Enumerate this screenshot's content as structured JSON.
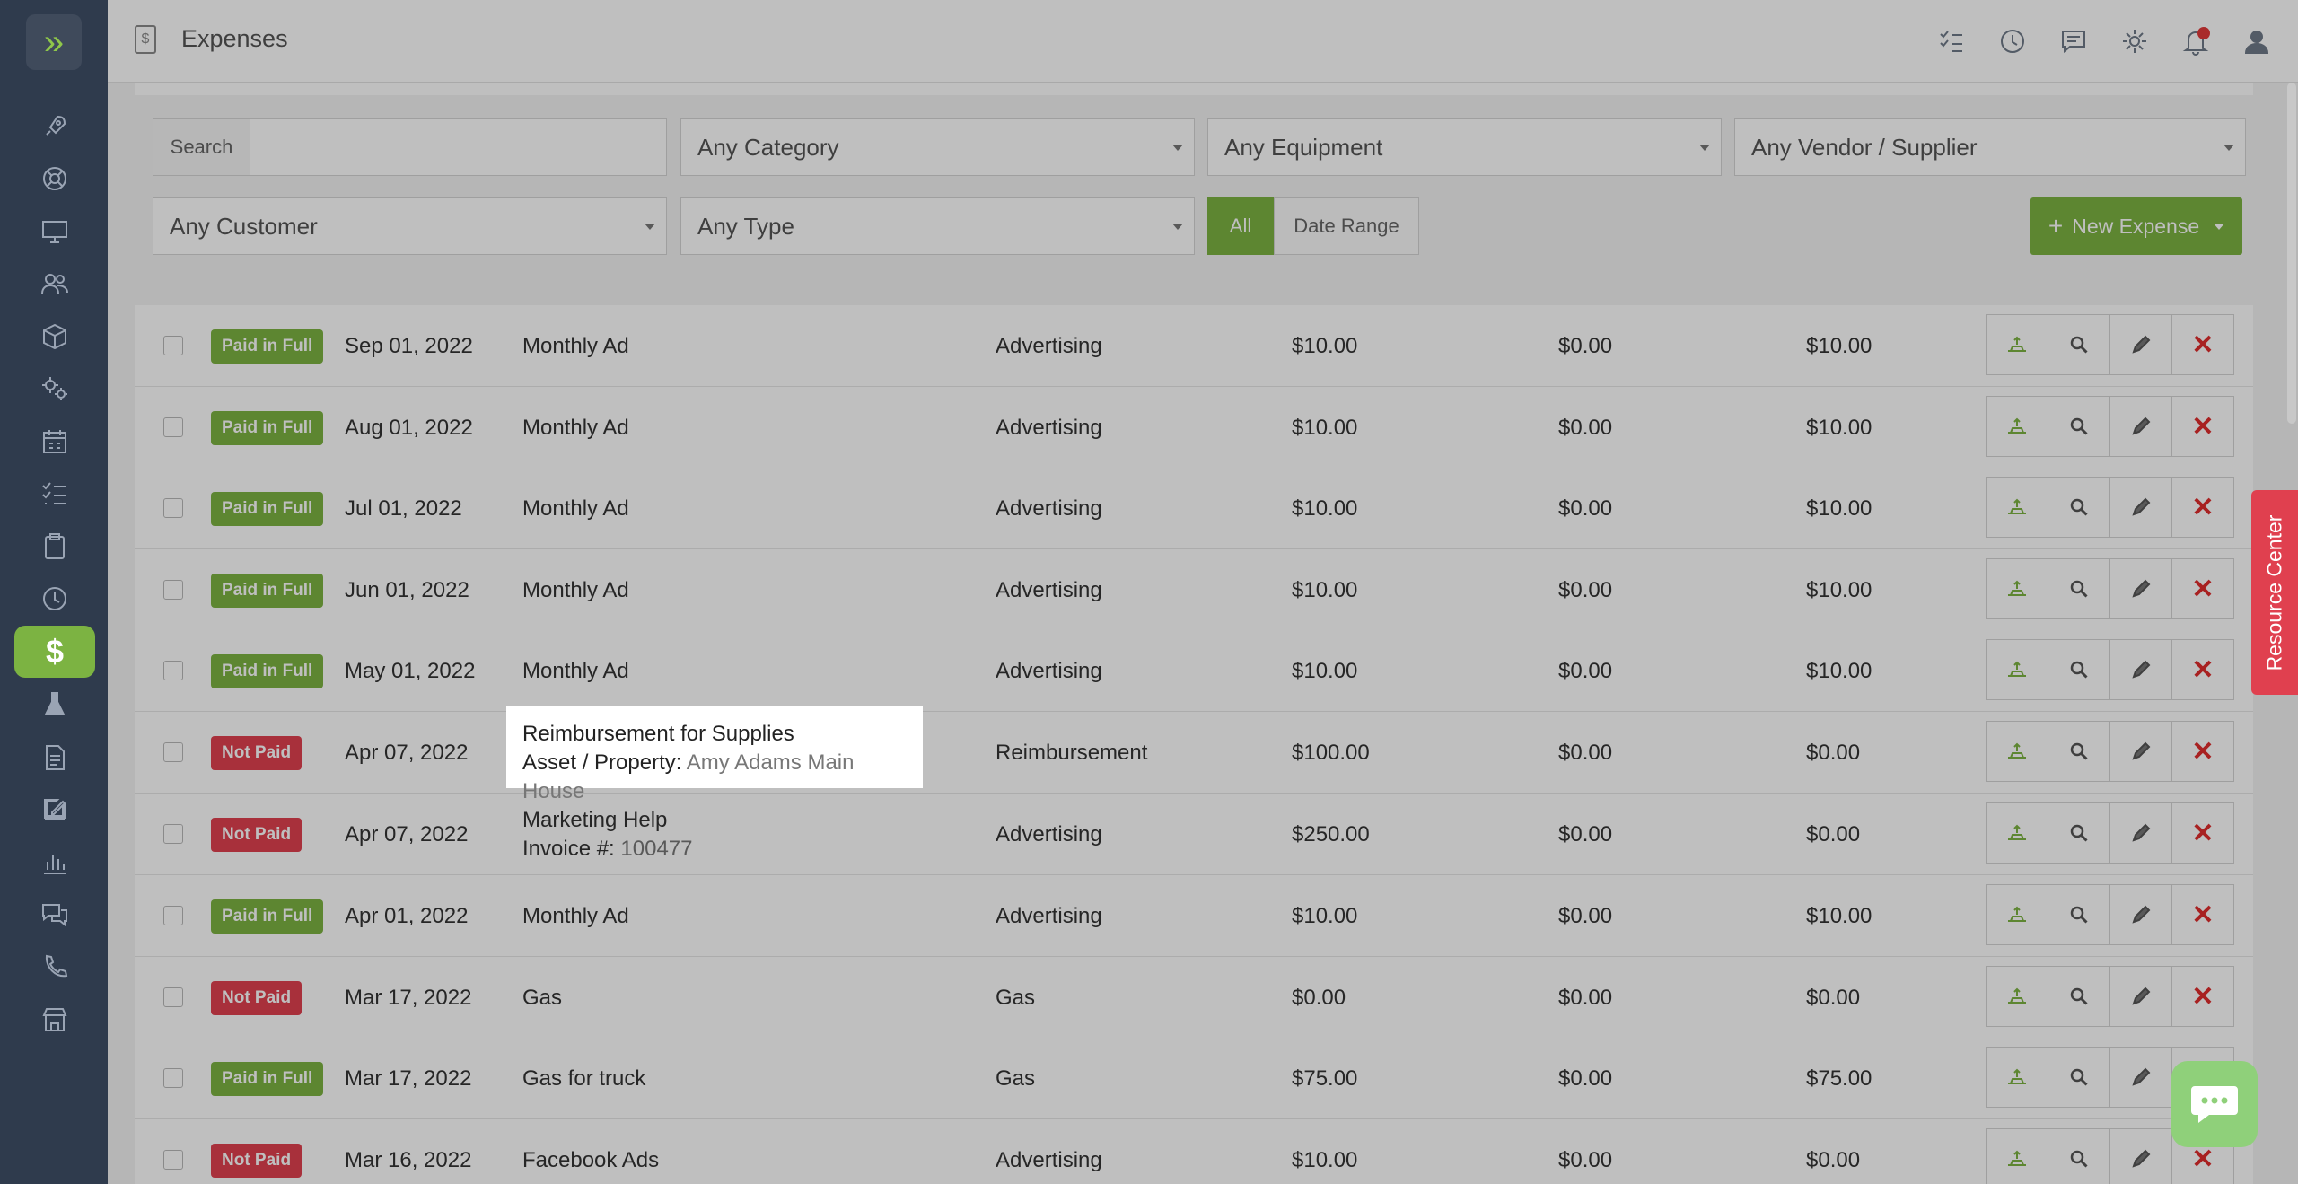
{
  "app": {
    "title": "Expenses"
  },
  "sidebar": {
    "items": [
      {
        "icon": "rocket-icon"
      },
      {
        "icon": "lifebuoy-icon"
      },
      {
        "icon": "desktop-icon"
      },
      {
        "icon": "users-icon"
      },
      {
        "icon": "cube-icon"
      },
      {
        "icon": "gears-icon"
      },
      {
        "icon": "calendar-icon"
      },
      {
        "icon": "checklist-icon"
      },
      {
        "icon": "clipboard-icon"
      },
      {
        "icon": "clock-icon"
      },
      {
        "icon": "dollar-icon",
        "label": "$",
        "active": true
      },
      {
        "icon": "flask-icon"
      },
      {
        "icon": "document-icon"
      },
      {
        "icon": "signature-icon"
      },
      {
        "icon": "bar-chart-icon"
      },
      {
        "icon": "chat-bubbles-icon"
      },
      {
        "icon": "phone-icon"
      },
      {
        "icon": "store-icon"
      }
    ]
  },
  "header_icons": [
    "tasks-icon",
    "history-icon",
    "message-icon",
    "gear-icon",
    "bell-icon",
    "user-icon"
  ],
  "filters": {
    "search_label": "Search",
    "search_value": "",
    "category": "Any Category",
    "equipment": "Any Equipment",
    "vendor": "Any Vendor / Supplier",
    "customer": "Any Customer",
    "type": "Any Type",
    "all_label": "All",
    "date_range_label": "Date Range",
    "new_expense_label": "New Expense"
  },
  "rows": [
    {
      "status": "Paid in Full",
      "status_kind": "paid",
      "date": "Sep 01, 2022",
      "description": "Monthly Ad",
      "category": "Advertising",
      "amount": "$10.00",
      "tax": "$0.00",
      "paid": "$10.00"
    },
    {
      "status": "Paid in Full",
      "status_kind": "paid",
      "date": "Aug 01, 2022",
      "description": "Monthly Ad",
      "category": "Advertising",
      "amount": "$10.00",
      "tax": "$0.00",
      "paid": "$10.00"
    },
    {
      "status": "Paid in Full",
      "status_kind": "paid",
      "date": "Jul 01, 2022",
      "description": "Monthly Ad",
      "category": "Advertising",
      "amount": "$10.00",
      "tax": "$0.00",
      "paid": "$10.00"
    },
    {
      "status": "Paid in Full",
      "status_kind": "paid",
      "date": "Jun 01, 2022",
      "description": "Monthly Ad",
      "category": "Advertising",
      "amount": "$10.00",
      "tax": "$0.00",
      "paid": "$10.00"
    },
    {
      "status": "Paid in Full",
      "status_kind": "paid",
      "date": "May 01, 2022",
      "description": "Monthly Ad",
      "category": "Advertising",
      "amount": "$10.00",
      "tax": "$0.00",
      "paid": "$10.00"
    },
    {
      "status": "Not Paid",
      "status_kind": "notpaid",
      "date": "Apr 07, 2022",
      "description": "Reimbursement for Supplies",
      "sub_label": "Asset / Property:",
      "sub_value": "Amy Adams Main House",
      "category": "Reimbursement",
      "amount": "$100.00",
      "tax": "$0.00",
      "paid": "$0.00",
      "highlight": true
    },
    {
      "status": "Not Paid",
      "status_kind": "notpaid",
      "date": "Apr 07, 2022",
      "description": "Marketing Help",
      "sub_label": "Invoice #:",
      "sub_value": "100477",
      "category": "Advertising",
      "amount": "$250.00",
      "tax": "$0.00",
      "paid": "$0.00"
    },
    {
      "status": "Paid in Full",
      "status_kind": "paid",
      "date": "Apr 01, 2022",
      "description": "Monthly Ad",
      "category": "Advertising",
      "amount": "$10.00",
      "tax": "$0.00",
      "paid": "$10.00"
    },
    {
      "status": "Not Paid",
      "status_kind": "notpaid",
      "date": "Mar 17, 2022",
      "description": "Gas",
      "category": "Gas",
      "amount": "$0.00",
      "tax": "$0.00",
      "paid": "$0.00"
    },
    {
      "status": "Paid in Full",
      "status_kind": "paid",
      "date": "Mar 17, 2022",
      "description": "Gas for truck",
      "category": "Gas",
      "amount": "$75.00",
      "tax": "$0.00",
      "paid": "$75.00"
    },
    {
      "status": "Not Paid",
      "status_kind": "notpaid",
      "date": "Mar 16, 2022",
      "description": "Facebook Ads",
      "category": "Advertising",
      "amount": "$10.00",
      "tax": "$0.00",
      "paid": "$0.00"
    }
  ],
  "resource_center": "Resource Center",
  "colors": {
    "sidebar": "#2f3b4d",
    "accent_green": "#7cb342",
    "danger_red": "#e0404f"
  }
}
